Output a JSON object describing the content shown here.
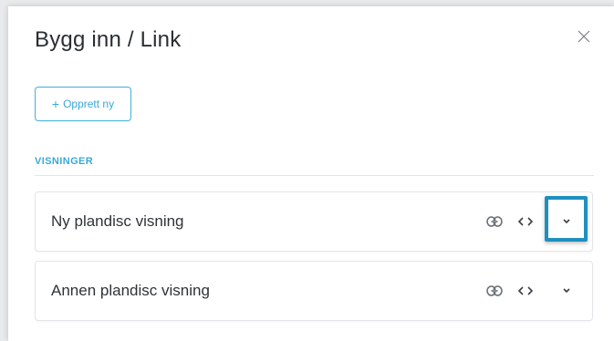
{
  "dialog": {
    "title": "Bygg inn / Link",
    "close_icon": "close-icon"
  },
  "actions": {
    "create_label": "Opprett ny",
    "create_icon": "plus-icon"
  },
  "section": {
    "heading": "VISNINGER"
  },
  "views": [
    {
      "label": "Ny plandisc visning",
      "icons": [
        "link-icon",
        "code-icon",
        "chevron-down-icon"
      ],
      "highlighted_control": "chevron-down-icon"
    },
    {
      "label": "Annen plandisc visning",
      "icons": [
        "link-icon",
        "code-icon",
        "chevron-down-icon"
      ]
    }
  ],
  "colors": {
    "accent": "#3aa9d5",
    "highlight_border": "#1f8fc0",
    "text": "#2f3337",
    "icon": "#6a6f75",
    "backdrop": "#e9eaeb"
  }
}
